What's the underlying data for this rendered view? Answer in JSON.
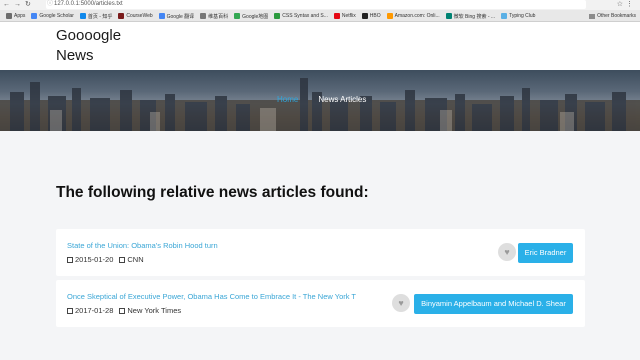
{
  "browser": {
    "url": "127.0.0.1:5000/articles.txt",
    "bookmarks": [
      {
        "label": "Apps",
        "color": "#6c6c6c"
      },
      {
        "label": "Google Scholar",
        "color": "#4285f4"
      },
      {
        "label": "首页 - 知乎",
        "color": "#0f88eb"
      },
      {
        "label": "CourseWeb",
        "color": "#7a1b1b"
      },
      {
        "label": "Google 翻译",
        "color": "#4285f4"
      },
      {
        "label": "维基百科",
        "color": "#777777"
      },
      {
        "label": "Google地图",
        "color": "#34a853"
      },
      {
        "label": "CSS Syntax and S...",
        "color": "#2b9a3e"
      },
      {
        "label": "Netflix",
        "color": "#e50914"
      },
      {
        "label": "HBO",
        "color": "#222222"
      },
      {
        "label": "Amazon.com: Onli...",
        "color": "#ff9900"
      },
      {
        "label": "微软 Bing 搜索 - ...",
        "color": "#008373"
      },
      {
        "label": "Typing Club",
        "color": "#5bb0e5"
      }
    ],
    "other_bookmarks": "Other Bookmarks"
  },
  "site": {
    "logo": "Goooogle News"
  },
  "hero": {
    "breadcrumb_home": "Home",
    "breadcrumb_current": "News Articles"
  },
  "main": {
    "heading": "The following relative news articles found:",
    "articles": [
      {
        "title": "State of the Union: Obama's Robin Hood turn",
        "date": "2015-01-20",
        "source": "CNN",
        "author": "Eric Bradner"
      },
      {
        "title": "Once Skeptical of Executive Power, Obama Has Come to Embrace It - The New York T",
        "date": "2017-01-28",
        "source": "New York Times",
        "author": "Binyamin Appelbaum and Michael D. Shear"
      }
    ]
  },
  "colors": {
    "accent": "#2ab0e8",
    "link": "#3aa6d6"
  }
}
